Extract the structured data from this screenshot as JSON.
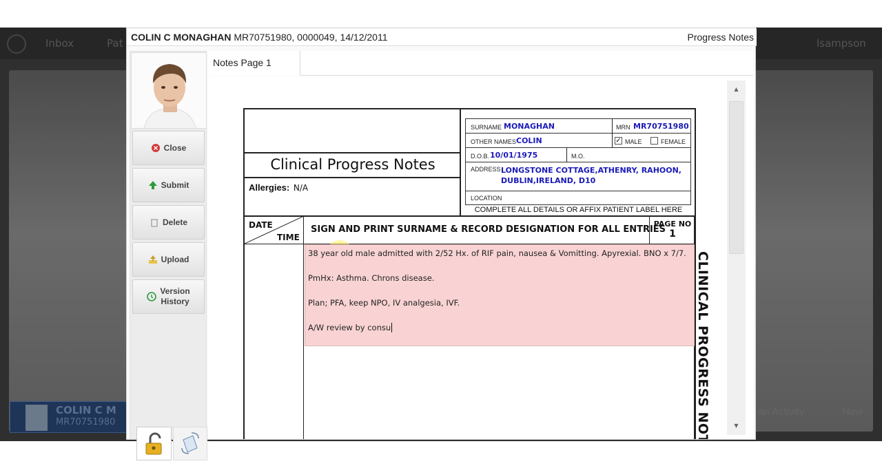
{
  "background": {
    "nav_items": [
      "Inbox",
      "Pat"
    ],
    "user": "lsampson",
    "patient_card": {
      "name": "COLIN C M",
      "mrn": "MR70751980"
    },
    "bottom_actions": [
      "an Activity",
      "New"
    ]
  },
  "window": {
    "patient_name": "COLIN C MONAGHAN",
    "patient_ids": "MR70751980, 0000049, 14/12/2011",
    "module": "Progress Notes"
  },
  "actions": {
    "close": "Close",
    "submit": "Submit",
    "delete": "Delete",
    "upload": "Upload",
    "version_history_1": "Version",
    "version_history_2": "History"
  },
  "tabs": [
    {
      "label": "Notes Page 1"
    }
  ],
  "form": {
    "title": "Clinical Progress Notes",
    "allergies_label": "Allergies:",
    "allergies_value": "N/A",
    "patient_label": {
      "surname_label": "SURNAME",
      "surname": "MONAGHAN",
      "mrn_label": "MRN",
      "mrn": "MR70751980",
      "other_names_label": "OTHER NAMES",
      "other_names": "COLIN",
      "male_label": "MALE",
      "female_label": "FEMALE",
      "male_checked": true,
      "female_checked": false,
      "dob_label": "D.O.B.",
      "dob": "10/01/1975",
      "mo_label": "M.O.",
      "address_label": "ADDRESS",
      "address_line1": "LONGSTONE COTTAGE,ATHENRY, RAHOON,",
      "address_line2": "DUBLIN,IRELAND, D10",
      "location_label": "LOCATION",
      "footer": "COMPLETE ALL DETAILS OR AFFIX PATIENT LABEL HERE"
    },
    "date_label": "DATE",
    "time_label": "TIME",
    "sign_instruction": "SIGN AND PRINT SURNAME & RECORD DESIGNATION FOR ALL ENTRIES",
    "page_no_label": "PAGE NO",
    "page_no": "1",
    "side_title": "CLINICAL PROGRESS NOTE",
    "notes": {
      "line1": "38 year old male admitted with 2/52 Hx. of RIF pain, nausea & Vomitting. Apyrexial. BNO x 7/7.",
      "line2": "PmHx: Asthma. Chrons disease.",
      "line3": "Plan; PFA, keep NPO, IV analgesia, IVF.",
      "line4": "A/W review by consu"
    }
  },
  "colors": {
    "notes_bg": "#f9d3d3",
    "label_value": "#1a1ab8"
  }
}
